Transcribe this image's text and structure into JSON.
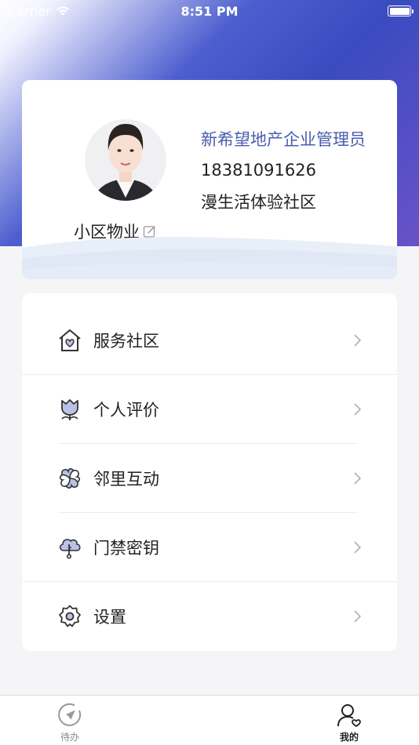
{
  "status_bar": {
    "carrier": "Carrier",
    "time": "8:51 PM"
  },
  "profile": {
    "name": "小区物业",
    "role": "新希望地产企业管理员",
    "phone": "18381091626",
    "community": "漫生活体验社区"
  },
  "menu": {
    "items": [
      {
        "label": "服务社区",
        "icon": "house-heart-icon"
      },
      {
        "label": "个人评价",
        "icon": "flower-rating-icon"
      },
      {
        "label": "邻里互动",
        "icon": "clover-icon"
      },
      {
        "label": "门禁密钥",
        "icon": "cloud-key-icon"
      },
      {
        "label": "设置",
        "icon": "gear-icon"
      }
    ]
  },
  "tab_bar": {
    "tabs": [
      {
        "label": "待办",
        "icon": "compass-icon",
        "active": false
      },
      {
        "label": "我的",
        "icon": "user-heart-icon",
        "active": true
      }
    ]
  },
  "colors": {
    "accent": "#4a5cae",
    "header_gradient_start": "#4d5fcf",
    "header_gradient_end": "#6a52c9"
  }
}
